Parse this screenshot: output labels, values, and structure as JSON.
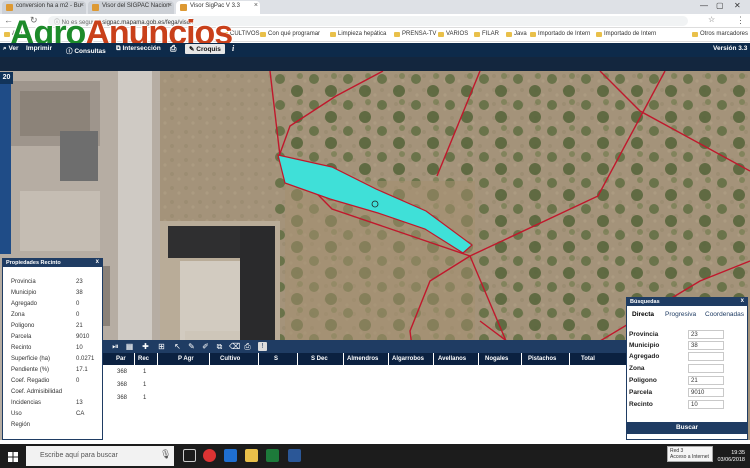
{
  "browser": {
    "tabs": [
      {
        "label": "conversion ha a m2 - Bu"
      },
      {
        "label": "Visor del SIGPAC Nacion"
      },
      {
        "label": "Visor SigPac V 3.3"
      }
    ],
    "security": "No es seguro",
    "url": "sigpac.mapama.gob.es/fega/visor/",
    "bookmarks": [
      "Apli",
      "CULTIVOS",
      "Con qué programar",
      "Limpieza hepática",
      "PRENSA-TV",
      "VARIOS",
      "FILAR",
      "Java",
      "Importado de Intern",
      "Importado de Intern",
      "Otros marcadores"
    ]
  },
  "logo": {
    "part1": "Agro",
    "part2": "Anuncios"
  },
  "toolbar": {
    "ver": "Ver",
    "imprimir": "Imprimir",
    "consultas": "Consultas",
    "interseccion": "Intersección",
    "croquis": "Croquis",
    "version": "Versión 3.3"
  },
  "map": {
    "zoom_level": "20"
  },
  "props": {
    "title": "Propiedades Recinto",
    "close": "x",
    "rows": [
      {
        "label": "Provincia",
        "value": "23"
      },
      {
        "label": "Municipio",
        "value": "38"
      },
      {
        "label": "Agregado",
        "value": "0"
      },
      {
        "label": "Zona",
        "value": "0"
      },
      {
        "label": "Poligono",
        "value": "21"
      },
      {
        "label": "Parcela",
        "value": "9010"
      },
      {
        "label": "Recinto",
        "value": "10"
      },
      {
        "label": "Superficie (ha)",
        "value": "0.0271"
      },
      {
        "label": "Pendiente (%)",
        "value": "17.1"
      },
      {
        "label": "Coef. Regadio",
        "value": "0"
      },
      {
        "label": "Coef. Admisibilidad",
        "value": ""
      },
      {
        "label": "Incidencias",
        "value": "13"
      },
      {
        "label": "Uso",
        "value": "CA"
      },
      {
        "label": "Región",
        "value": ""
      }
    ]
  },
  "table": {
    "columns": [
      "Par",
      "Rec",
      "P Agr",
      "Cultivo",
      "S",
      "S Dec",
      "Almendros",
      "Algarrobos",
      "Avellanos",
      "Nogales",
      "Pistachos",
      "Total"
    ],
    "rows": [
      {
        "par": "368",
        "rec": "1"
      },
      {
        "par": "368",
        "rec": "1"
      },
      {
        "par": "368",
        "rec": "1"
      }
    ]
  },
  "search": {
    "title": "Búsquedas",
    "close": "x",
    "tabs": [
      "Directa",
      "Progresiva",
      "Coordenadas"
    ],
    "fields": [
      {
        "label": "Provincia",
        "value": "23"
      },
      {
        "label": "Municipio",
        "value": "38"
      },
      {
        "label": "Agregado",
        "value": ""
      },
      {
        "label": "Zona",
        "value": ""
      },
      {
        "label": "Poligono",
        "value": "21"
      },
      {
        "label": "Parcela",
        "value": "9010"
      },
      {
        "label": "Recinto",
        "value": "10"
      }
    ],
    "button": "Buscar"
  },
  "taskbar": {
    "search_placeholder": "Escribe aquí para buscar",
    "tooltip_line1": "Red 3",
    "tooltip_line2": "Acceso a Internet",
    "time": "19:35",
    "date": "03/06/2018"
  },
  "colors": {
    "toolbar": "#0d2a4a",
    "parcel": "#3fe0d8",
    "boundary": "#c0182c"
  }
}
